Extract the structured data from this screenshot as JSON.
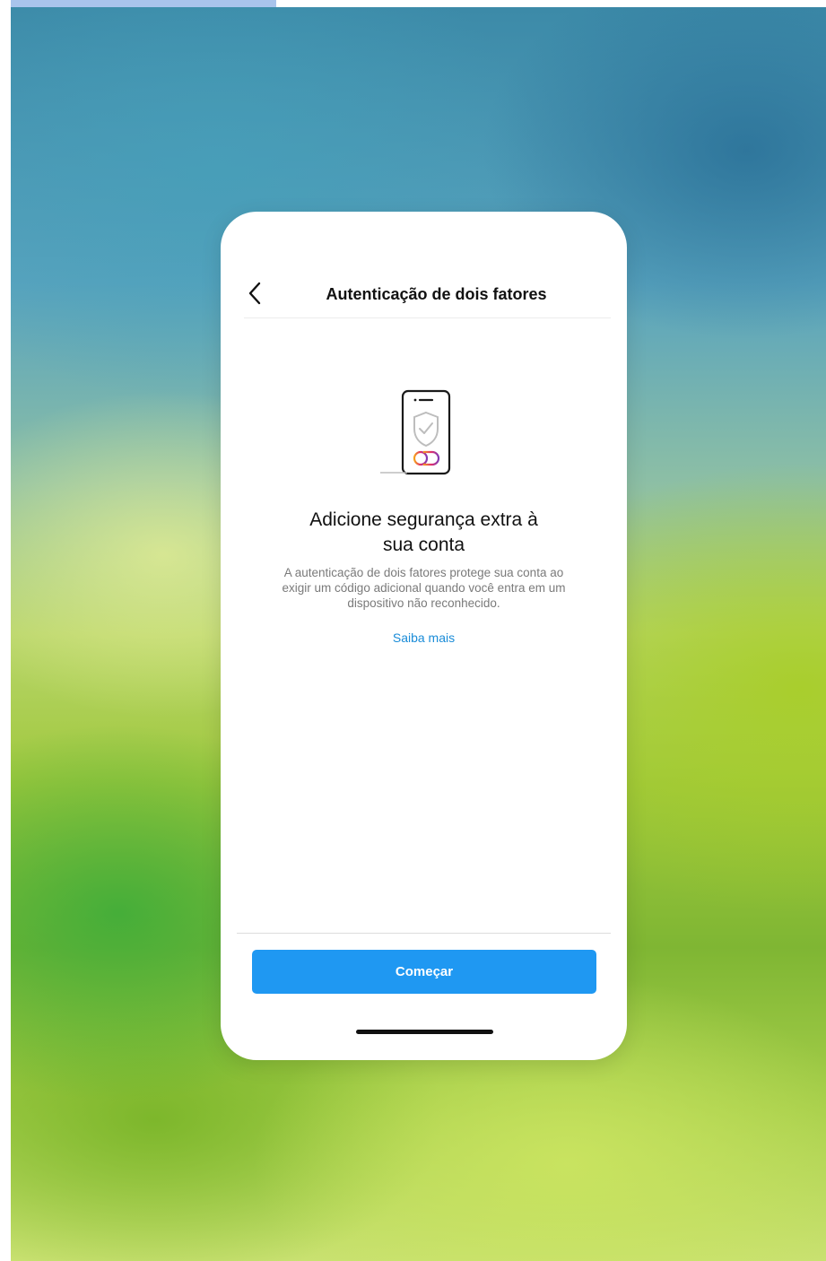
{
  "header": {
    "title": "Autenticação de dois fatores",
    "back_icon": "chevron-left-icon"
  },
  "main": {
    "illustration_icon": "phone-shield-icon",
    "headline_line1": "Adicione segurança extra à",
    "headline_line2": "sua conta",
    "description_line1": "A autenticação de dois fatores protege sua conta ao",
    "description_line2": "exigir um código adicional quando você entra em um",
    "description_line3": "dispositivo não reconhecido.",
    "learn_more": "Saiba mais"
  },
  "footer": {
    "cta_label": "Começar"
  },
  "colors": {
    "accent": "#1f98f2",
    "link": "#1a8cd8",
    "text_primary": "#111111",
    "text_secondary": "#7a7a7a"
  }
}
